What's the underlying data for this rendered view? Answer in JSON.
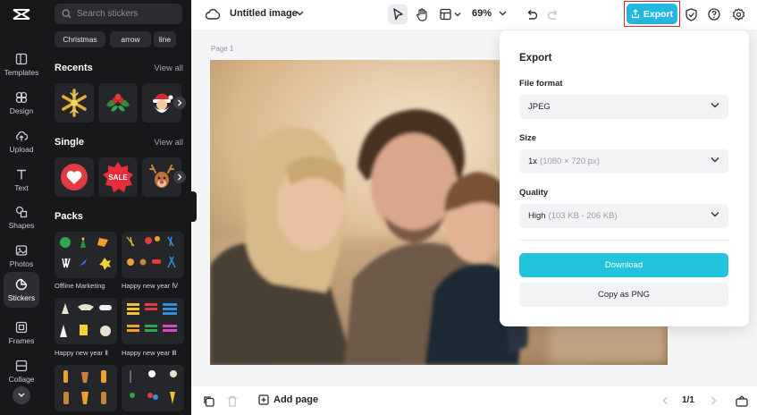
{
  "rail": {
    "items": [
      {
        "label": "Templates",
        "icon": "templates-icon"
      },
      {
        "label": "Design",
        "icon": "design-icon"
      },
      {
        "label": "Upload",
        "icon": "upload-icon"
      },
      {
        "label": "Text",
        "icon": "text-icon"
      },
      {
        "label": "Shapes",
        "icon": "shapes-icon"
      },
      {
        "label": "Photos",
        "icon": "photos-icon"
      },
      {
        "label": "Stickers",
        "icon": "stickers-icon",
        "active": true
      },
      {
        "label": "Frames",
        "icon": "frames-icon"
      },
      {
        "label": "Collage",
        "icon": "collage-icon"
      }
    ]
  },
  "stickers": {
    "search_placeholder": "Search stickers",
    "chips": [
      "Christmas",
      "arrow",
      "line"
    ],
    "recents": {
      "title": "Recents",
      "view_all": "View all"
    },
    "single": {
      "title": "Single",
      "view_all": "View all"
    },
    "packs": {
      "title": "Packs",
      "items": [
        "Offline Marketing",
        "Happy new year Ⅳ",
        "Happy new year Ⅱ",
        "Happy new year Ⅲ"
      ]
    }
  },
  "topbar": {
    "doc_title": "Untitled image",
    "zoom": "69%",
    "export_label": "Export"
  },
  "canvas": {
    "page_label": "Page 1"
  },
  "bottombar": {
    "add_page": "Add page",
    "pager": "1/1"
  },
  "export_panel": {
    "title": "Export",
    "file_format_label": "File format",
    "file_format_value": "JPEG",
    "size_label": "Size",
    "size_value": "1x",
    "size_detail": "(1080 × 720 px)",
    "quality_label": "Quality",
    "quality_value": "High",
    "quality_detail": "(103 KB - 206 KB)",
    "download_label": "Download",
    "copy_label": "Copy as PNG"
  },
  "colors": {
    "accent": "#22b8e0",
    "download": "#22c3dc",
    "highlight": "#e0232e",
    "sidebar": "#17181a"
  }
}
